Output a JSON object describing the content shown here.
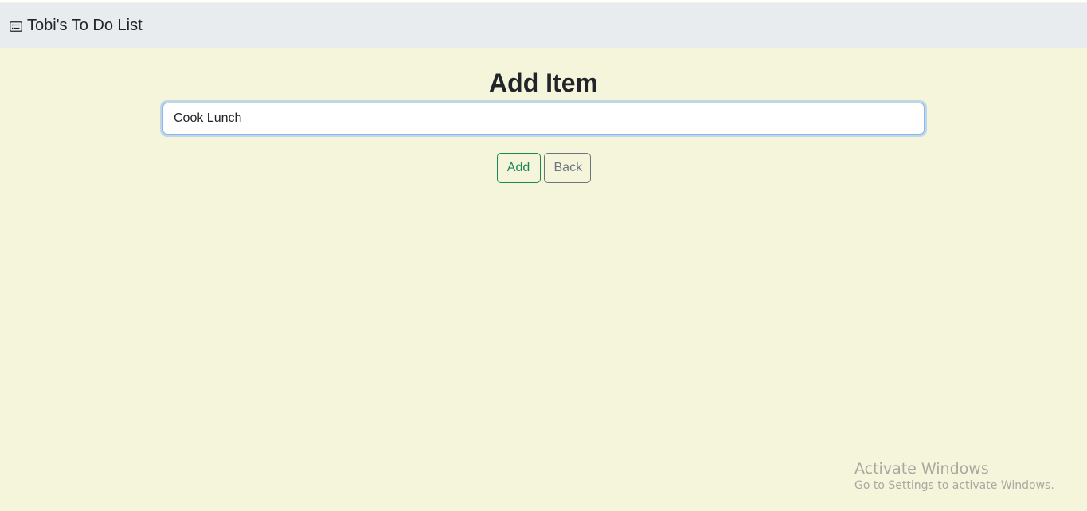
{
  "navbar": {
    "brand_icon": "card-list-icon",
    "brand_title": "Tobi's To Do List"
  },
  "main": {
    "heading": "Add Item",
    "item_input_value": "Cook Lunch",
    "add_label": "Add",
    "back_label": "Back"
  },
  "watermark": {
    "title": "Activate Windows",
    "subtitle": "Go to Settings to activate Windows."
  },
  "colors": {
    "background": "#f5f5dc",
    "navbar": "#e9ecef",
    "add_button": "#198754",
    "back_button": "#6c757d",
    "input_focus": "#86b7fe"
  }
}
